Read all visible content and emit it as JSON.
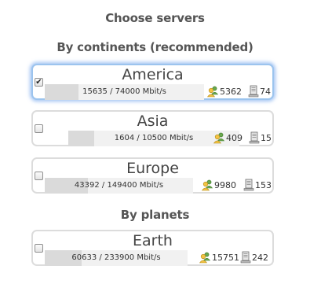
{
  "page": {
    "title": "Choose servers",
    "continents_heading": "By continents (recommended)",
    "planets_heading": "By planets"
  },
  "colors": {
    "selected_glow": "#5a96eb",
    "card_border": "#dcdcdc",
    "bar_bg": "#f1f1f1",
    "bar_fill": "#dadada"
  },
  "icons": {
    "users": "users-icon",
    "servers": "server-icon"
  },
  "continents": [
    {
      "name": "America",
      "checked": true,
      "checkmark": "✔",
      "bandwidth": "15635 / 74000 Mbit/s",
      "usage_fraction": 0.211,
      "users": "5362",
      "servers": "74"
    },
    {
      "name": "Asia",
      "checked": false,
      "checkmark": "",
      "bandwidth": "1604 / 10500 Mbit/s",
      "usage_fraction": 0.153,
      "users": "409",
      "servers": "15"
    },
    {
      "name": "Europe",
      "checked": false,
      "checkmark": "",
      "bandwidth": "43392 / 149400 Mbit/s",
      "usage_fraction": 0.29,
      "users": "9980",
      "servers": "153"
    }
  ],
  "planets": [
    {
      "name": "Earth",
      "checked": false,
      "checkmark": "",
      "bandwidth": "60633 / 233900 Mbit/s",
      "usage_fraction": 0.259,
      "users": "15751",
      "servers": "242"
    }
  ]
}
